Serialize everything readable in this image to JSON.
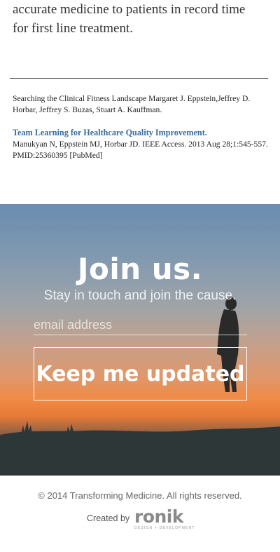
{
  "article": {
    "lines": [
      "accurate medicine to patients in record time",
      "for first line treatment."
    ]
  },
  "references": {
    "ref1": "Searching the Clinical Fitness Landscape Margaret J. Eppstein,Jeffrey D. Horbar, Jeffrey S. Buzas, Stuart A. Kauffman.",
    "ref2_title": "Team Learning for Healthcare Quality Improvement.",
    "ref2_body": "Manukyan N, Eppstein MJ, Horbar JD. IEEE Access. 2013 Aug 28;1:545-557. PMID:25360395 [PubMed]"
  },
  "signup": {
    "heading": "Join us.",
    "subheading": "Stay in touch and join the cause.",
    "email_placeholder": "email address",
    "button_label": "Keep me updated"
  },
  "footer": {
    "copyright": "© 2014 Transforming Medicine. All rights reserved.",
    "created_by": "Created by",
    "brand": "ronik",
    "brand_tagline": "DESIGN + DEVELOPMENT"
  }
}
